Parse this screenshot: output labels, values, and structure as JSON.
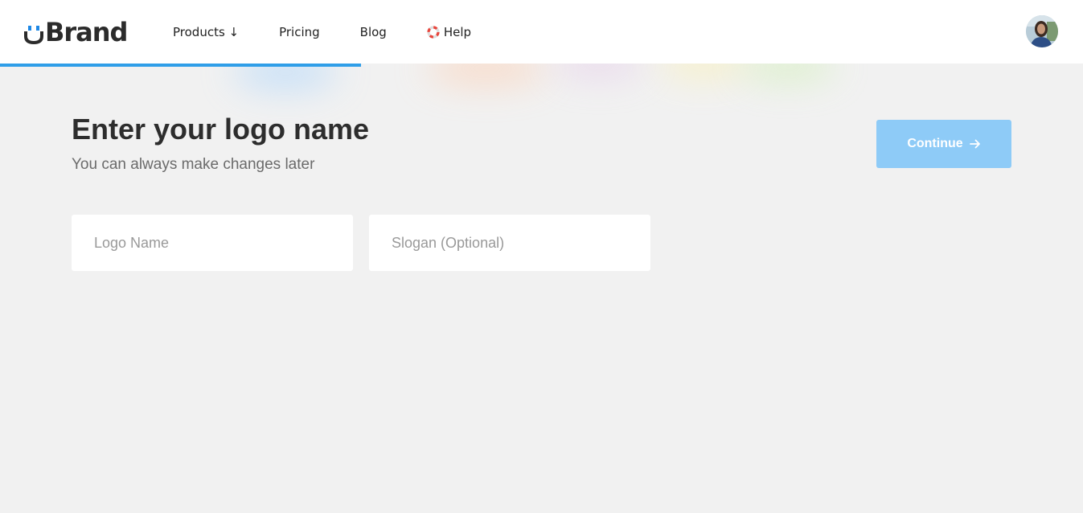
{
  "brand": {
    "name": "Brand",
    "accent": "#1e88e5"
  },
  "nav": {
    "items": [
      {
        "label": "Products ↓"
      },
      {
        "label": "Pricing"
      },
      {
        "label": "Blog"
      },
      {
        "label": "Help",
        "icon": "lifebuoy-icon"
      }
    ]
  },
  "progress": {
    "fraction": 0.333,
    "color": "#2f9ee8"
  },
  "main": {
    "title": "Enter your logo name",
    "subtitle": "You can always make changes later",
    "continue_label": "Continue",
    "continue_icon": "arrow-right-icon",
    "continue_color": "#8ecbf7",
    "logo_name_placeholder": "Logo Name",
    "logo_name_value": "",
    "slogan_placeholder": "Slogan (Optional)",
    "slogan_value": ""
  }
}
